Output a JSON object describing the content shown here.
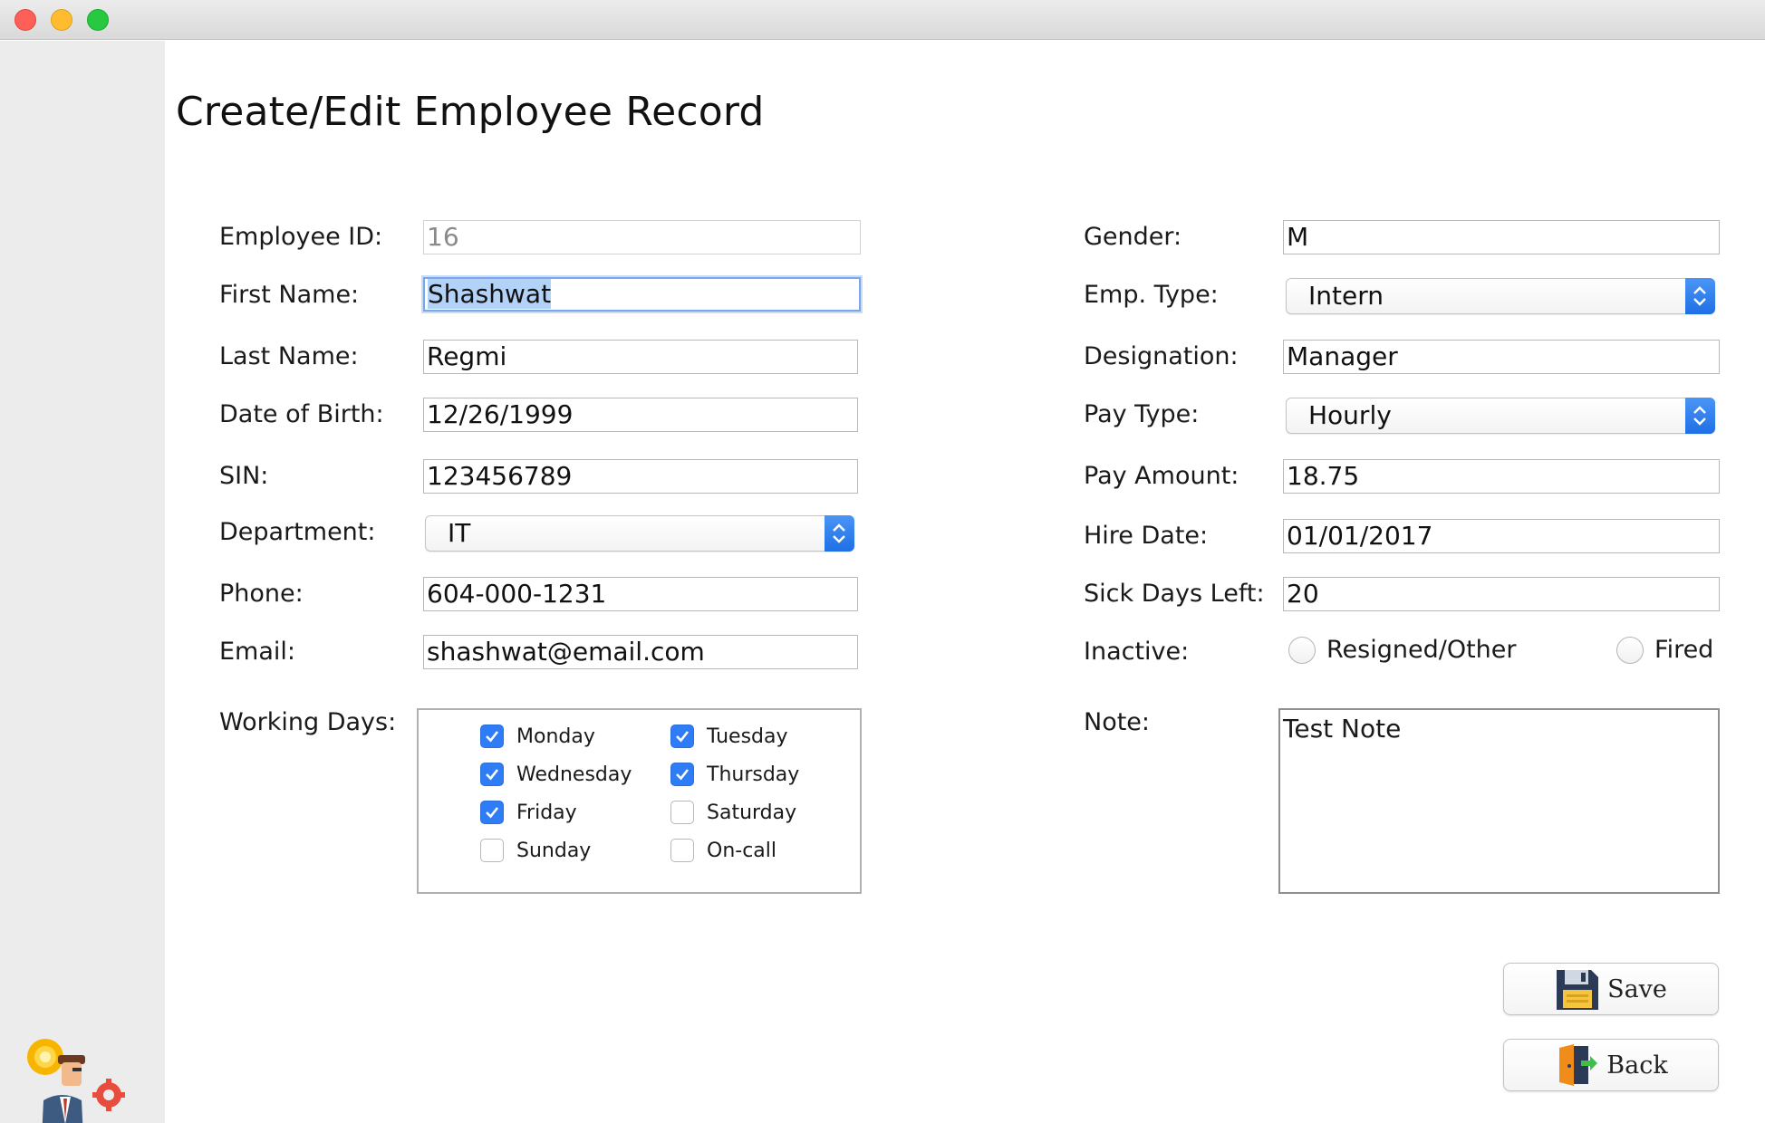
{
  "window": {
    "controls": [
      "close",
      "minimize",
      "maximize"
    ]
  },
  "page": {
    "title": "Create/Edit Employee Record"
  },
  "left": {
    "employee_id": {
      "label": "Employee ID:",
      "value": "16"
    },
    "first_name": {
      "label": "First Name:",
      "value": "Shashwat"
    },
    "last_name": {
      "label": "Last Name:",
      "value": "Regmi"
    },
    "dob": {
      "label": "Date of Birth:",
      "value": "12/26/1999"
    },
    "sin": {
      "label": "SIN:",
      "value": "123456789"
    },
    "department": {
      "label": "Department:",
      "value": "IT"
    },
    "phone": {
      "label": "Phone:",
      "value": "604-000-1231"
    },
    "email": {
      "label": "Email:",
      "value": "shashwat@email.com"
    },
    "working_days": {
      "label": "Working Days:",
      "days": [
        {
          "label": "Monday",
          "checked": true
        },
        {
          "label": "Tuesday",
          "checked": true
        },
        {
          "label": "Wednesday",
          "checked": true
        },
        {
          "label": "Thursday",
          "checked": true
        },
        {
          "label": "Friday",
          "checked": true
        },
        {
          "label": "Saturday",
          "checked": false
        },
        {
          "label": "Sunday",
          "checked": false
        },
        {
          "label": "On-call",
          "checked": false
        }
      ]
    }
  },
  "right": {
    "gender": {
      "label": "Gender:",
      "value": "M"
    },
    "emp_type": {
      "label": "Emp. Type:",
      "value": "Intern"
    },
    "designation": {
      "label": "Designation:",
      "value": "Manager"
    },
    "pay_type": {
      "label": "Pay Type:",
      "value": "Hourly"
    },
    "pay_amount": {
      "label": "Pay Amount:",
      "value": "18.75"
    },
    "hire_date": {
      "label": "Hire Date:",
      "value": "01/01/2017"
    },
    "sick_days": {
      "label": "Sick Days Left:",
      "value": "20"
    },
    "inactive": {
      "label": "Inactive:",
      "options": [
        {
          "label": "Resigned/Other",
          "selected": false
        },
        {
          "label": "Fired",
          "selected": false
        }
      ]
    },
    "note": {
      "label": "Note:",
      "value": "Test Note"
    }
  },
  "buttons": {
    "save": "Save",
    "back": "Back"
  },
  "colors": {
    "accent": "#2f7df6",
    "selection": "#b3d2f7",
    "sidebar": "#ececec"
  }
}
